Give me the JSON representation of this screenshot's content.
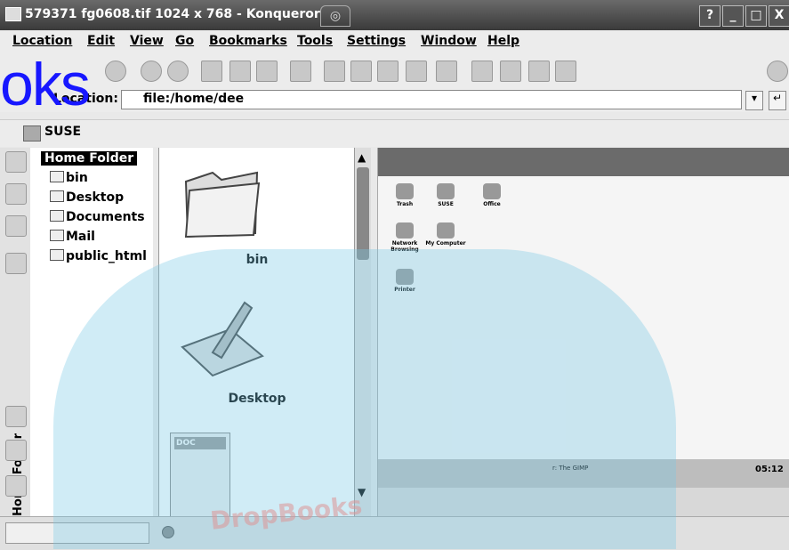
{
  "window": {
    "title": "579371 fg0608.tif 1024 x 768 - Konqueror",
    "buttons": [
      "?",
      "_",
      "□",
      "X"
    ]
  },
  "menu": [
    "Location",
    "Edit",
    "View",
    "Go",
    "Bookmarks",
    "Tools",
    "Settings",
    "Window",
    "Help"
  ],
  "location": {
    "label": "Location:",
    "value": "file:/home/dee"
  },
  "bookmarks_bar": {
    "item": "SUSE"
  },
  "sidebar": {
    "vertical_tab": "Home Folder",
    "tree_root": "Home Folder",
    "items": [
      {
        "label": "bin"
      },
      {
        "label": "Desktop"
      },
      {
        "label": "Documents"
      },
      {
        "label": "Mail"
      },
      {
        "label": "public_html"
      }
    ]
  },
  "icon_view": {
    "items": [
      {
        "label": "bin"
      },
      {
        "label": "Desktop"
      }
    ],
    "doc_badge": "DOC"
  },
  "preview": {
    "desktop_icons": [
      {
        "label": "Trash"
      },
      {
        "label": "SUSE"
      },
      {
        "label": "Office"
      },
      {
        "label": "Network Browsing"
      },
      {
        "label": "My Computer"
      },
      {
        "label": "Printer"
      }
    ],
    "taskbar_text": "r: The GIMP",
    "clock": "05:12"
  },
  "watermark": {
    "text": "oks",
    "text2": "DropBooks"
  }
}
